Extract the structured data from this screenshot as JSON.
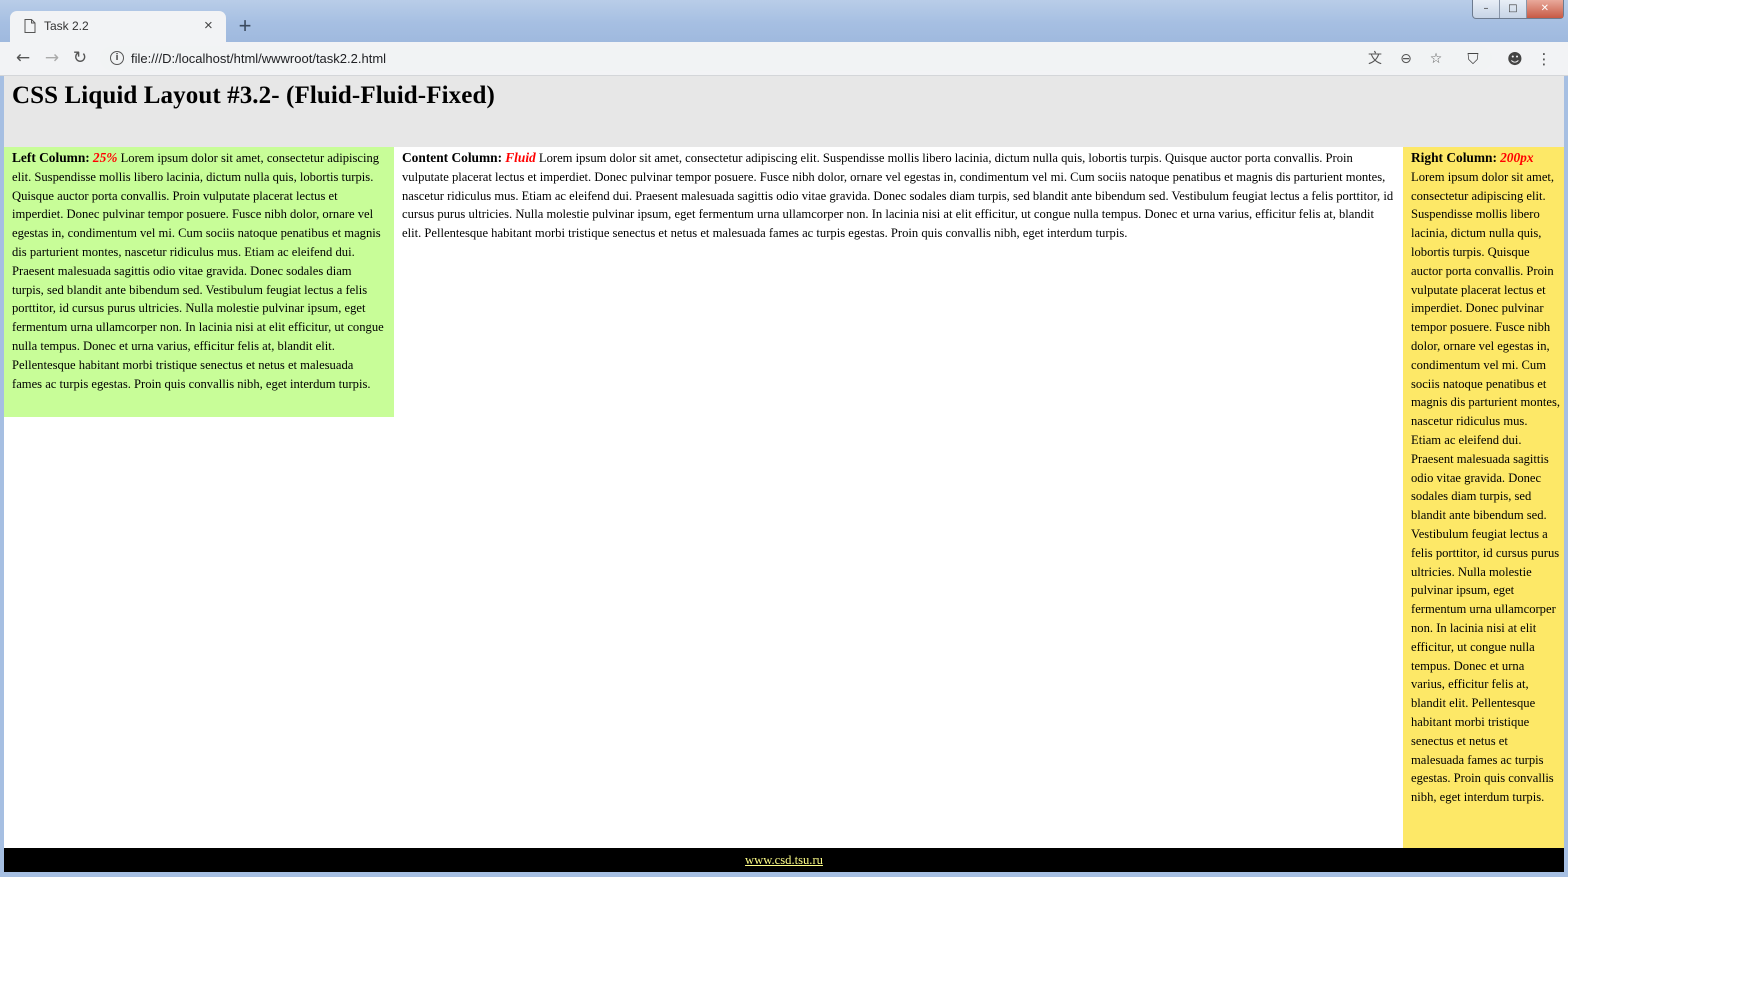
{
  "browser": {
    "tab_title": "Task 2.2",
    "tab_close": "×",
    "new_tab": "+",
    "url": "file:///D:/localhost/html/wwwroot/task2.2.html",
    "window_controls": {
      "minimize": "–",
      "maximize": "□",
      "close": "✕"
    },
    "nav": {
      "back": "←",
      "forward": "→",
      "reload": "↻"
    },
    "icons": {
      "translate": "文",
      "zoom": "⊖",
      "bookmark": "☆",
      "shield": "⛉",
      "account": "☻",
      "menu": "⋮",
      "info": "i"
    }
  },
  "page": {
    "title": "CSS Liquid Layout #3.2- (Fluid-Fluid-Fixed)",
    "left": {
      "label": "Left Column:",
      "width_note": "25%",
      "text": "Lorem ipsum dolor sit amet, consectetur adipiscing elit. Suspendisse mollis libero lacinia, dictum nulla quis, lobortis turpis. Quisque auctor porta convallis. Proin vulputate placerat lectus et imperdiet. Donec pulvinar tempor posuere. Fusce nibh dolor, ornare vel egestas in, condimentum vel mi. Cum sociis natoque penatibus et magnis dis parturient montes, nascetur ridiculus mus. Etiam ac eleifend dui. Praesent malesuada sagittis odio vitae gravida. Donec sodales diam turpis, sed blandit ante bibendum sed. Vestibulum feugiat lectus a felis porttitor, id cursus purus ultricies. Nulla molestie pulvinar ipsum, eget fermentum urna ullamcorper non. In lacinia nisi at elit efficitur, ut congue nulla tempus. Donec et urna varius, efficitur felis at, blandit elit. Pellentesque habitant morbi tristique senectus et netus et malesuada fames ac turpis egestas. Proin quis convallis nibh, eget interdum turpis."
    },
    "content": {
      "label": "Content Column:",
      "width_note": "Fluid",
      "text": "Lorem ipsum dolor sit amet, consectetur adipiscing elit. Suspendisse mollis libero lacinia, dictum nulla quis, lobortis turpis. Quisque auctor porta convallis. Proin vulputate placerat lectus et imperdiet. Donec pulvinar tempor posuere. Fusce nibh dolor, ornare vel egestas in, condimentum vel mi. Cum sociis natoque penatibus et magnis dis parturient montes, nascetur ridiculus mus. Etiam ac eleifend dui. Praesent malesuada sagittis odio vitae gravida. Donec sodales diam turpis, sed blandit ante bibendum sed. Vestibulum feugiat lectus a felis porttitor, id cursus purus ultricies. Nulla molestie pulvinar ipsum, eget fermentum urna ullamcorper non. In lacinia nisi at elit efficitur, ut congue nulla tempus. Donec et urna varius, efficitur felis at, blandit elit. Pellentesque habitant morbi tristique senectus et netus et malesuada fames ac turpis egestas. Proin quis convallis nibh, eget interdum turpis."
    },
    "right": {
      "label": "Right Column:",
      "width_note": "200px",
      "text": "Lorem ipsum dolor sit amet, consectetur adipiscing elit. Suspendisse mollis libero lacinia, dictum nulla quis, lobortis turpis. Quisque auctor porta convallis. Proin vulputate placerat lectus et imperdiet. Donec pulvinar tempor posuere. Fusce nibh dolor, ornare vel egestas in, condimentum vel mi. Cum sociis natoque penatibus et magnis dis parturient montes, nascetur ridiculus mus. Etiam ac eleifend dui. Praesent malesuada sagittis odio vitae gravida. Donec sodales diam turpis, sed blandit ante bibendum sed. Vestibulum feugiat lectus a felis porttitor, id cursus purus ultricies. Nulla molestie pulvinar ipsum, eget fermentum urna ullamcorper non. In lacinia nisi at elit efficitur, ut congue nulla tempus. Donec et urna varius, efficitur felis at, blandit elit. Pellentesque habitant morbi tristique senectus et netus et malesuada fames ac turpis egestas. Proin quis convallis nibh, eget interdum turpis."
    },
    "footer_link": "www.csd.tsu.ru"
  },
  "colors": {
    "header_bg": "#e7e7e7",
    "left_bg": "#c8fd98",
    "right_bg": "#fde867",
    "footer_bg": "#000000",
    "footer_link": "#ffff88",
    "accent_red": "#ff0000"
  }
}
